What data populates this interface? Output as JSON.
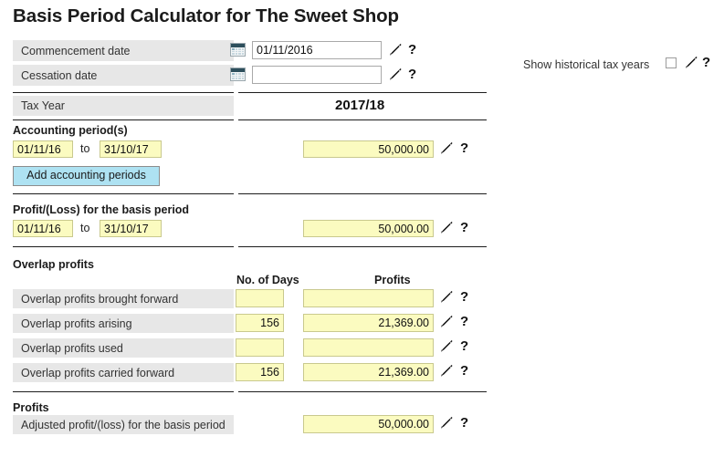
{
  "page": {
    "title": "Basis Period Calculator for The Sweet Shop"
  },
  "top_fields": [
    {
      "label": "Commencement date",
      "value": "01/11/2016",
      "icon": "calendar-icon",
      "edit_icon": "pencil-icon",
      "help_icon": "question-mark-icon"
    },
    {
      "label": "Cessation date",
      "value": "",
      "icon": "calendar-icon",
      "edit_icon": "pencil-icon",
      "help_icon": "question-mark-icon"
    }
  ],
  "historical": {
    "label": "Show historical tax years",
    "checked": false,
    "edit_icon": "pencil-icon",
    "help_icon": "question-mark-icon"
  },
  "tax_year": {
    "label": "Tax Year",
    "value": "2017/18"
  },
  "accounting_periods": {
    "heading": "Accounting period(s)",
    "to_word": "to",
    "rows": [
      {
        "from": "01/11/16",
        "to": "31/10/17",
        "amount": "50,000.00"
      }
    ],
    "add_button": "Add accounting periods"
  },
  "basis_period": {
    "heading": "Profit/(Loss) for the basis period",
    "to_word": "to",
    "from": "01/11/16",
    "to": "31/10/17",
    "amount": "50,000.00"
  },
  "overlap": {
    "heading": "Overlap profits",
    "columns": [
      "No. of Days",
      "Profits"
    ],
    "rows": [
      {
        "label": "Overlap profits brought forward",
        "days": "",
        "profits": ""
      },
      {
        "label": "Overlap profits arising",
        "days": "156",
        "profits": "21,369.00"
      },
      {
        "label": "Overlap profits used",
        "days": "",
        "profits": ""
      },
      {
        "label": "Overlap profits carried forward",
        "days": "156",
        "profits": "21,369.00"
      }
    ]
  },
  "profits": {
    "heading": "Profits",
    "row": {
      "label": "Adjusted profit/(loss) for the basis period",
      "value": "50,000.00"
    }
  },
  "colors": {
    "field_yellow": "#fbfbc0",
    "label_grey": "#e7e7e7",
    "button_blue": "#aee2f2",
    "text": "#1a1a1a"
  }
}
